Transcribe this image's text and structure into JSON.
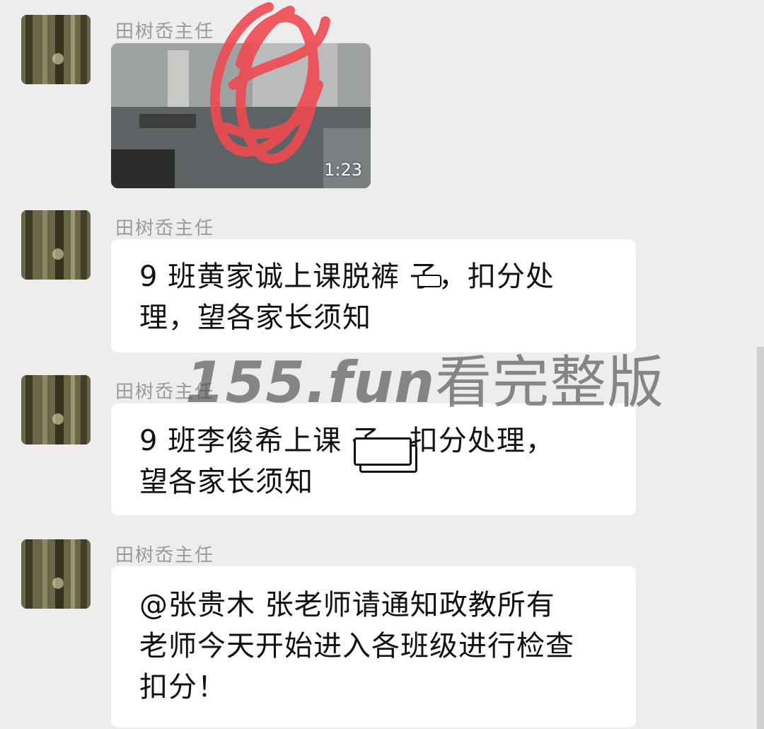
{
  "messages": [
    {
      "sender": "田树岙主任",
      "type": "video",
      "duration": "1:23"
    },
    {
      "sender": "田树岙主任",
      "type": "text",
      "lines": [
        "9 班黄家诚上课脱裤 子，扣分处",
        "理，望各家长须知"
      ]
    },
    {
      "sender": "田树岙主任",
      "type": "text",
      "lines": [
        "9 班李俊希上课  子，扣分处理，",
        "望各家长须知"
      ]
    },
    {
      "sender": "田树岙主任",
      "type": "text",
      "lines": [
        "@张贵木  张老师请通知政教所有",
        "老师今天开始进入各班级进行检查",
        "扣分！"
      ]
    }
  ],
  "watermark": {
    "domain": "155.fun",
    "text": "看完整版"
  },
  "colors": {
    "background": "#ededed",
    "bubble": "#ffffff",
    "scribble": "#f04a52"
  }
}
